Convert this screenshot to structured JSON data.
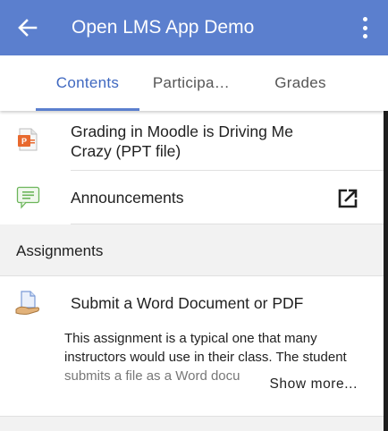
{
  "appbar": {
    "title": "Open LMS App Demo",
    "back_icon": "arrow-left-icon",
    "menu_icon": "more-vertical-icon",
    "color": "#5b7fce"
  },
  "tabs": [
    {
      "label": "Contents",
      "active": true
    },
    {
      "label": "Participa…",
      "active": false
    },
    {
      "label": "Grades",
      "active": false
    }
  ],
  "items": [
    {
      "title": "Grading in Moodle is Driving Me Crazy (PPT file)",
      "title_line1": "Grading in Moodle is Driving Me",
      "title_line2": "Crazy (PPT file)",
      "icon": "powerpoint-file-icon"
    },
    {
      "title": "Announcements",
      "icon": "forum-icon",
      "action_icon": "external-link-icon"
    }
  ],
  "section": {
    "title": "Assignments",
    "items": [
      {
        "title": "Submit a Word Document or PDF",
        "icon": "assignment-icon",
        "description_line1": "This assignment is a typical one that many",
        "description_line2": "instructors would use in their class. The student",
        "description_line3": "submits a file as a Word docu",
        "show_more": "Show more..."
      }
    ]
  }
}
